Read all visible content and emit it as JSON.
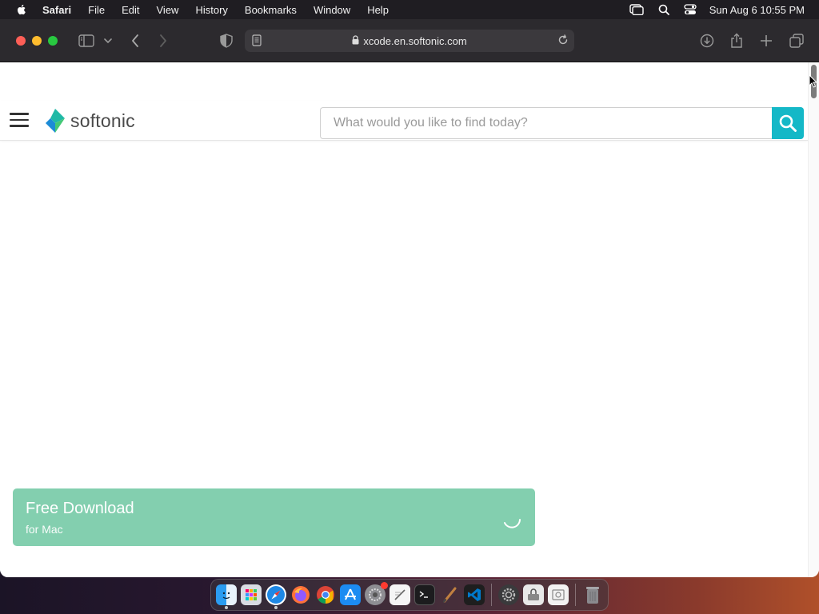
{
  "menubar": {
    "app_name": "Safari",
    "items": [
      "File",
      "Edit",
      "View",
      "History",
      "Bookmarks",
      "Window",
      "Help"
    ],
    "clock": "Sun Aug 6  10:55 PM"
  },
  "browser": {
    "url": "xcode.en.softonic.com"
  },
  "site": {
    "logo_text": "softonic",
    "search_placeholder": "What would you like to find today?",
    "download": {
      "title": "Free Download",
      "subtitle": "for Mac",
      "color": "#83cfaf"
    },
    "accent_color": "#14b8c7"
  },
  "dock": {
    "apps": [
      "finder-icon",
      "launchpad-icon",
      "safari-icon",
      "firefox-icon",
      "chrome-icon",
      "app-store-icon",
      "system-preferences-icon",
      "textedit-icon",
      "terminal-icon",
      "paintbrush-icon",
      "vscode-icon",
      "settings-icon",
      "disk-utility-icon",
      "preview-icon",
      "trash-icon"
    ]
  }
}
